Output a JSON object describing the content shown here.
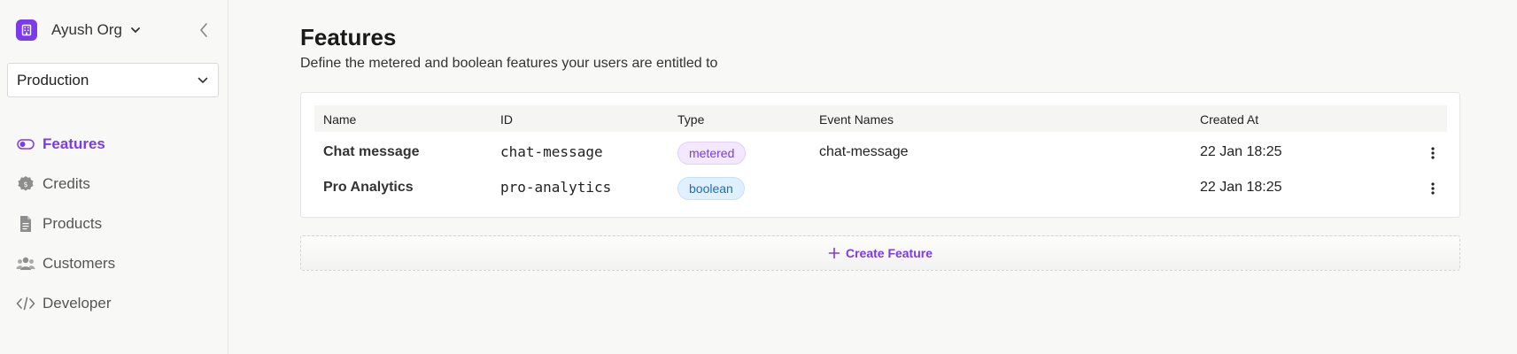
{
  "sidebar": {
    "org_name": "Ayush Org",
    "environment": "Production",
    "items": [
      {
        "label": "Features",
        "icon": "toggle-icon",
        "active": true
      },
      {
        "label": "Credits",
        "icon": "coin-badge-icon",
        "active": false
      },
      {
        "label": "Products",
        "icon": "document-icon",
        "active": false
      },
      {
        "label": "Customers",
        "icon": "users-icon",
        "active": false
      },
      {
        "label": "Developer",
        "icon": "code-icon",
        "active": false
      }
    ]
  },
  "main": {
    "title": "Features",
    "subtitle": "Define the metered and boolean features your users are entitled to",
    "table": {
      "columns": [
        "Name",
        "ID",
        "Type",
        "Event Names",
        "Created At"
      ],
      "rows": [
        {
          "name": "Chat message",
          "id": "chat-message",
          "type": "metered",
          "event_names": "chat-message",
          "created_at": "22 Jan 18:25"
        },
        {
          "name": "Pro Analytics",
          "id": "pro-analytics",
          "type": "boolean",
          "event_names": "",
          "created_at": "22 Jan 18:25"
        }
      ]
    },
    "create_label": "Create Feature"
  },
  "colors": {
    "accent": "#7c3aed",
    "metered_badge_bg": "#f3e8ff",
    "boolean_badge_bg": "#e0f0ff",
    "boolean_badge_text": "#1d6fb8"
  }
}
